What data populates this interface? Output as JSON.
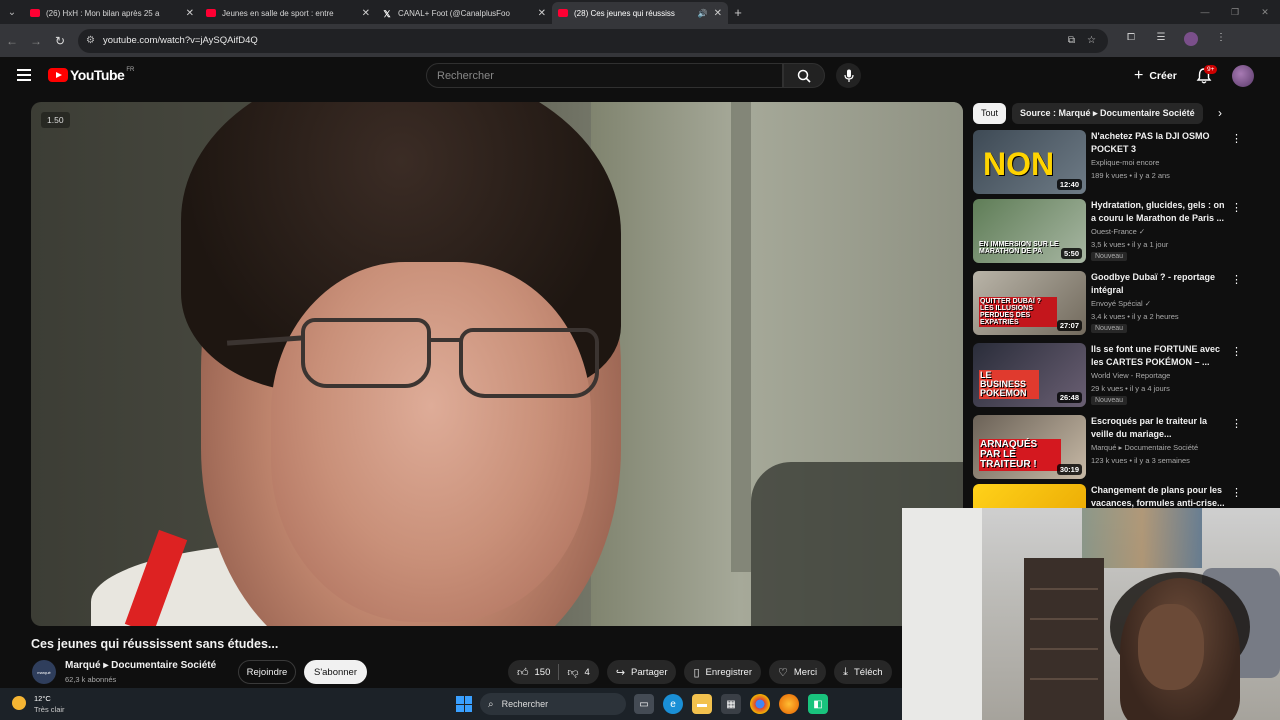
{
  "browser": {
    "tabs": [
      {
        "title": "(26) HxH : Mon bilan après 25 a",
        "favicon": "youtube-icon",
        "active": false
      },
      {
        "title": "Jeunes en salle de sport : entre",
        "favicon": "youtube-icon",
        "active": false
      },
      {
        "title": "CANAL+ Foot (@CanalplusFoo",
        "favicon": "x-icon",
        "active": false
      },
      {
        "title": "(28) Ces jeunes qui réussiss",
        "favicon": "youtube-icon",
        "active": true,
        "audio": true
      }
    ],
    "url": "youtube.com/watch?v=jAySQAifD4Q"
  },
  "youtube": {
    "logo_text": "YouTube",
    "country_code": "FR",
    "search_placeholder": "Rechercher",
    "create_label": "Créer",
    "notifications_badge": "9+"
  },
  "player": {
    "speed_overlay": "1.50"
  },
  "video": {
    "title": "Ces jeunes qui réussissent sans études...",
    "channel": "Marqué ▸ Documentaire Société",
    "channel_avatar_text": "marqué",
    "subscribers": "62,3 k abonnés",
    "join_label": "Rejoindre",
    "subscribe_label": "S'abonner",
    "likes": "150",
    "dislikes": "4",
    "share_label": "Partager",
    "save_label": "Enregistrer",
    "thanks_label": "Merci",
    "download_label": "Téléch"
  },
  "sidebar": {
    "chips": [
      "Tout",
      "Source : Marqué ▸ Documentaire Société"
    ],
    "recommendations": [
      {
        "title": "N'achetez PAS la DJI OSMO POCKET 3",
        "channel": "Explique-moi encore",
        "meta": "189 k vues • il y a 2 ans",
        "duration": "12:40",
        "overlay": "NON",
        "new": ""
      },
      {
        "title": "Hydratation, glucides, gels : on a couru le Marathon de Paris ...",
        "channel": "Ouest-France ✓",
        "meta": "3,5 k vues • il y a 1 jour",
        "duration": "5:50",
        "overlay": "EN IMMERSION SUR LE MARATHON DE PA",
        "new": "Nouveau"
      },
      {
        "title": "Goodbye Dubaï ? - reportage intégral",
        "channel": "Envoyé Spécial ✓",
        "meta": "3,4 k vues • il y a 2 heures",
        "duration": "27:07",
        "overlay": "QUITTER DUBAÏ ? LES ILLUSIONS PERDUES DES EXPATRIÉS",
        "new": "Nouveau"
      },
      {
        "title": "Ils se font une FORTUNE avec les CARTES POKÉMON – ...",
        "channel": "World View - Reportage",
        "meta": "29 k vues • il y a 4 jours",
        "duration": "26:48",
        "overlay": "LE BUSINESS POKEMON",
        "new": "Nouveau"
      },
      {
        "title": "Escroqués par le traiteur la veille du mariage...",
        "channel": "Marqué ▸ Documentaire Société",
        "meta": "123 k vues • il y a 3 semaines",
        "duration": "30:19",
        "overlay": "ARNAQUÉS PAR LE TRAITEUR !",
        "new": ""
      },
      {
        "title": "Changement de plans pour les vacances, formules anti-crise...",
        "channel": "",
        "meta": "",
        "duration": "",
        "overlay": "",
        "new": ""
      }
    ]
  },
  "taskbar": {
    "temperature": "12°C",
    "weather": "Très clair",
    "search_label": "Rechercher"
  },
  "colors": {
    "youtube_red": "#ff0000",
    "background": "#0f0f0f",
    "chip_bg": "#272727"
  }
}
